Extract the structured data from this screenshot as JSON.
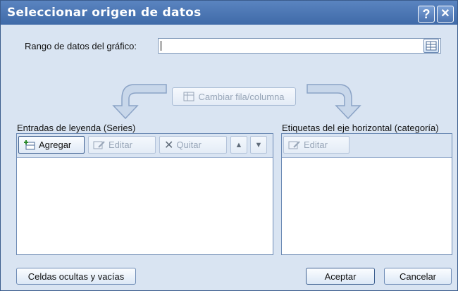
{
  "window": {
    "title": "Seleccionar origen de datos",
    "help_label": "?",
    "close_label": "✕"
  },
  "range": {
    "label": "Rango de datos del gráfico:",
    "value": ""
  },
  "switch_button": {
    "label": "Cambiar fila/columna"
  },
  "legend": {
    "title": "Entradas de leyenda (Series)",
    "add_label": "Agregar",
    "edit_label": "Editar",
    "remove_label": "Quitar",
    "items": []
  },
  "axis": {
    "title": "Etiquetas del eje horizontal (categoría)",
    "edit_label": "Editar",
    "items": []
  },
  "footer": {
    "hidden_empty_label": "Celdas ocultas y vacías",
    "ok_label": "Aceptar",
    "cancel_label": "Cancelar"
  },
  "colors": {
    "titlebar": "#4a76b4",
    "body": "#d9e4f2",
    "border": "#6d8bb5"
  }
}
